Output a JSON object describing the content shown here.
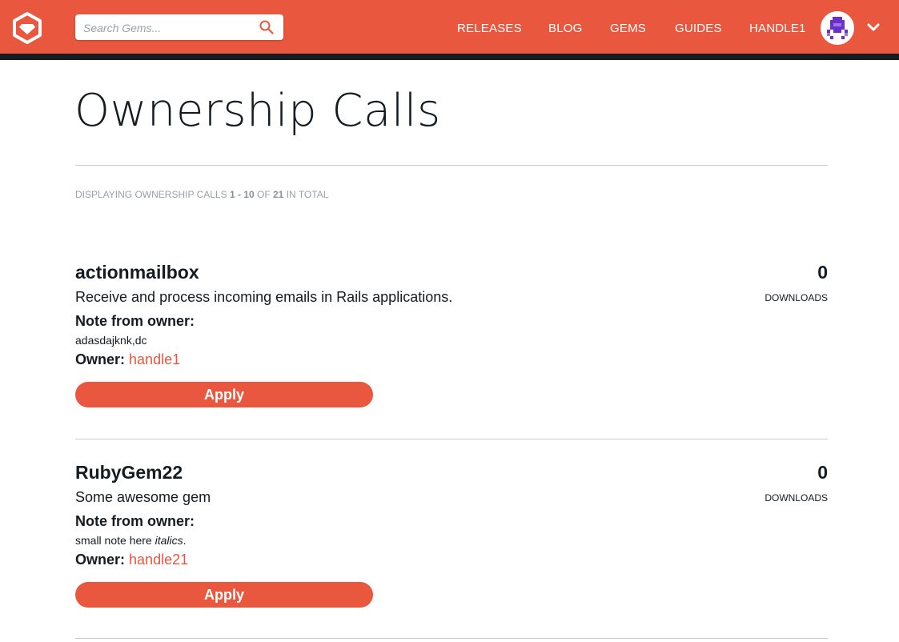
{
  "header": {
    "search_placeholder": "Search Gems...",
    "nav": {
      "releases": "RELEASES",
      "blog": "BLOG",
      "gems": "GEMS",
      "guides": "GUIDES",
      "user": "HANDLE1"
    },
    "colors": {
      "brand": "#e9573f",
      "border": "#141c22"
    }
  },
  "page": {
    "title": "Ownership Calls",
    "summary": {
      "prefix": "Displaying ownership calls",
      "range": "1 - 10",
      "of": "of",
      "total": "21",
      "suffix": "in total"
    }
  },
  "calls": [
    {
      "name": "actionmailbox",
      "description": "Receive and process incoming emails in Rails applications.",
      "note_label": "Note from owner:",
      "note": "adasdajknk,dc",
      "owner_label": "Owner:",
      "owner": "handle1",
      "downloads": "0",
      "downloads_label": "DOWNLOADS",
      "apply_label": "Apply"
    },
    {
      "name": "RubyGem22",
      "description": "Some awesome gem",
      "note_label": "Note from owner:",
      "note_plain": "small note here ",
      "note_italic": "italics",
      "note_end": ".",
      "owner_label": "Owner:",
      "owner": "handle21",
      "downloads": "0",
      "downloads_label": "DOWNLOADS",
      "apply_label": "Apply"
    }
  ]
}
